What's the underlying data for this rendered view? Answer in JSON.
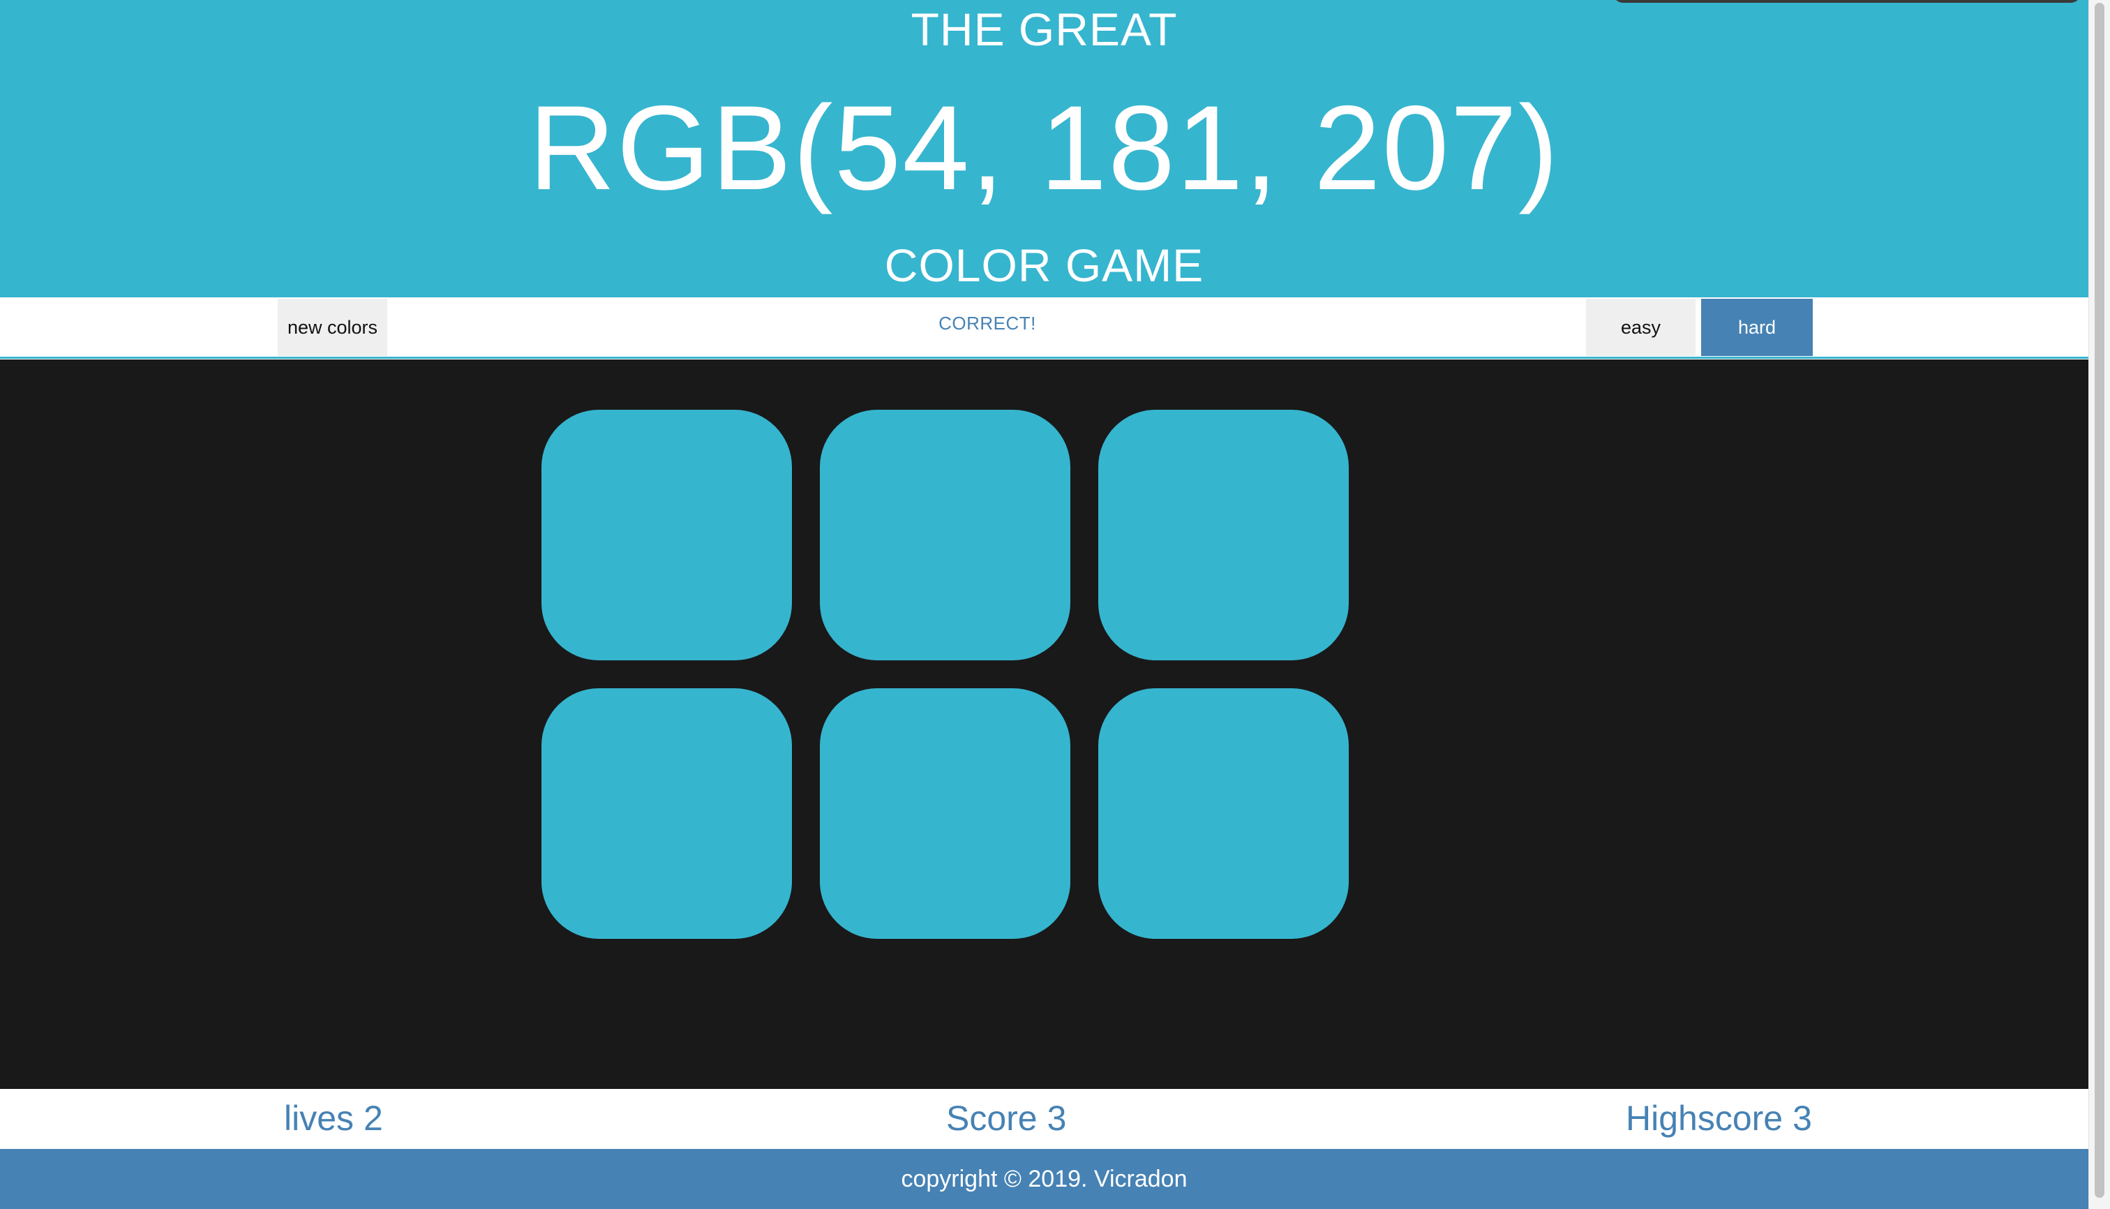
{
  "header": {
    "subtitle_top": "THE GREAT",
    "rgb_text": "RGB(54, 181, 207)",
    "subtitle_bottom": "COLOR GAME",
    "background_color": "#36b5cf"
  },
  "controls": {
    "new_colors_label": "new colors",
    "message": "CORRECT!",
    "easy_label": "easy",
    "hard_label": "hard",
    "active_mode": "hard",
    "accent_color": "#4682b4"
  },
  "board": {
    "background_color": "#191919",
    "squares": [
      {
        "color": "#36b5cf"
      },
      {
        "color": "#36b5cf"
      },
      {
        "color": "#36b5cf"
      },
      {
        "color": "#36b5cf"
      },
      {
        "color": "#36b5cf"
      },
      {
        "color": "#36b5cf"
      }
    ]
  },
  "stats": {
    "lives_label": "lives",
    "lives_value": "2",
    "score_label": "Score",
    "score_value": "3",
    "highscore_label": "Highscore",
    "highscore_value": "3"
  },
  "footer": {
    "text": "copyright © 2019. Vicradon"
  }
}
